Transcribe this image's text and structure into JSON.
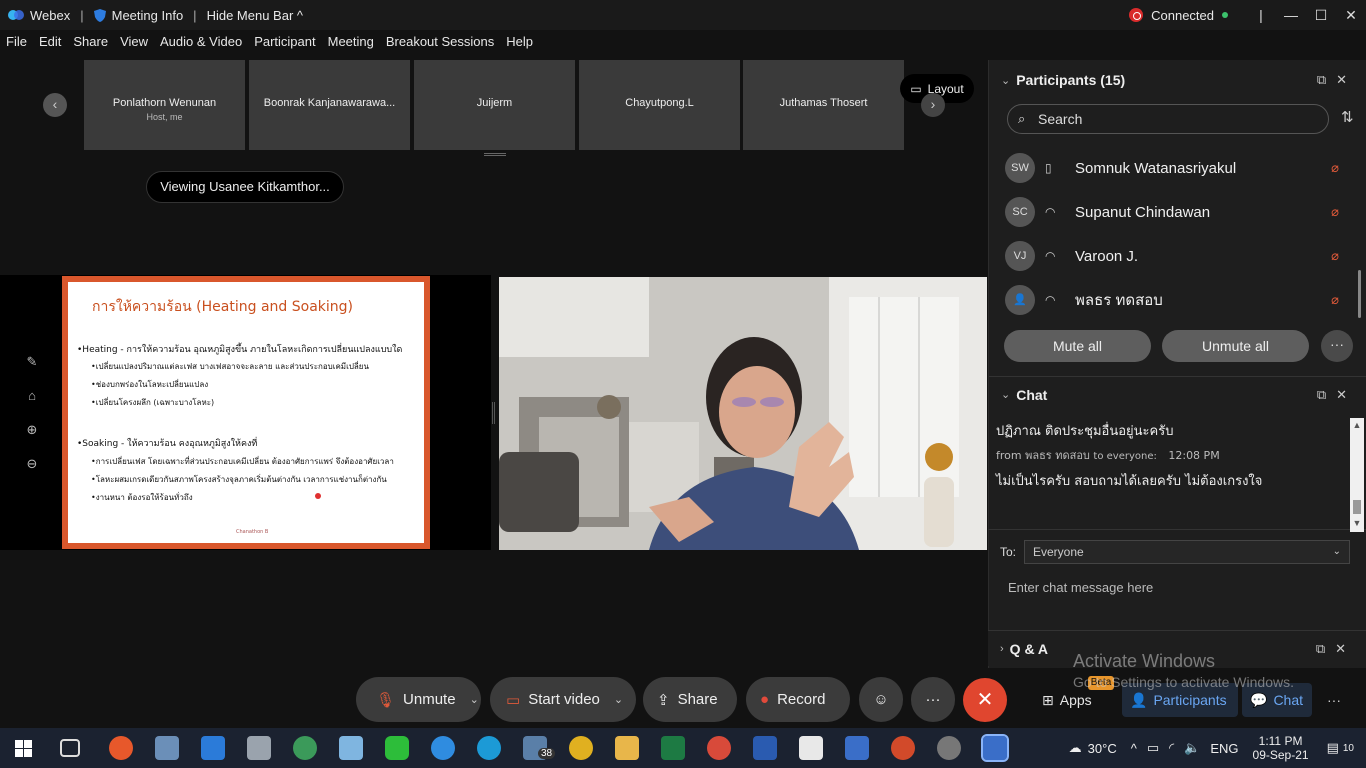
{
  "titlebar": {
    "app": "Webex",
    "meeting_info": "Meeting Info",
    "hide_menu": "Hide Menu Bar ^",
    "status": "Connected",
    "minimize": "—",
    "maximize": "☐",
    "close": "✕"
  },
  "menu": [
    "File",
    "Edit",
    "Share",
    "View",
    "Audio & Video",
    "Participant",
    "Meeting",
    "Breakout Sessions",
    "Help"
  ],
  "filmstrip": {
    "tiles": [
      {
        "name": "Ponlathorn Wenunan",
        "sub": "Host, me"
      },
      {
        "name": "Boonrak Kanjanawarawa..."
      },
      {
        "name": "Juijerm"
      },
      {
        "name": "Chayutpong.L"
      },
      {
        "name": "Juthamas Thosert"
      }
    ],
    "layout_label": "Layout"
  },
  "viewing": "Viewing Usanee Kitkamthor...",
  "slide": {
    "title": "การให้ความร้อน (Heating and Soaking)",
    "bullet1": "•Heating - การให้ความร้อน อุณหภูมิสูงขึ้น ภายในโลหะเกิดการเปลี่ยนแปลงแบบใด",
    "sub1": [
      "•เปลี่ยนแปลงปริมาณแต่ละเฟส  บางเฟสอาจจะละลาย และส่วนประกอบเคมีเปลี่ยน",
      "•ช่องบกพร่องในโลหะเปลี่ยนแปลง",
      "•เปลี่ยนโครงผลึก (เฉพาะบางโลหะ)"
    ],
    "bullet2": "•Soaking - ให้ความร้อน คงอุณหภูมิสูงให้คงที่",
    "sub2": [
      "•การเปลี่ยนเฟส โดยเฉพาะที่ส่วนประกอบเคมีเปลี่ยน ต้องอาศัยการแพร่ จึงต้องอาศัยเวลา",
      "•โลหะผสมเกรดเดียวกันสภาพโครงสร้างจุลภาคเริ่มต้นต่างกัน เวลาการแช่งานก็ต่างกัน",
      "•งานหนา ต้องรอให้ร้อนทั่วถึง"
    ],
    "footer": "Chanathon B"
  },
  "controls": {
    "unmute": "Unmute",
    "start_video": "Start video",
    "share": "Share",
    "record": "Record",
    "more": "···",
    "apps": "Apps",
    "participants": "Participants",
    "chat": "Chat",
    "beta": "Beta"
  },
  "participants": {
    "header": "Participants (15)",
    "search_placeholder": "Search",
    "rows": [
      {
        "initials": "SW",
        "name": "Somnuk Watanasriyakul"
      },
      {
        "initials": "SC",
        "name": "Supanut Chindawan"
      },
      {
        "initials": "VJ",
        "name": "Varoon J."
      },
      {
        "initials": "",
        "name": "พลธร ทดสอบ"
      }
    ],
    "mute_all": "Mute all",
    "unmute_all": "Unmute all"
  },
  "chat": {
    "header": "Chat",
    "prev_message": "ปฏิภาณ ติดประชุมอื่นอยู่นะครับ",
    "from_label": "from พลธร ทดสอบ",
    "to_label": "to everyone:",
    "time": "12:08 PM",
    "message": "ไม่เป็นไรครับ สอบถามได้เลยครับ ไม่ต้องเกรงใจ",
    "to": "To:",
    "recipient": "Everyone",
    "placeholder": "Enter chat message here"
  },
  "qa": {
    "header": "Q & A"
  },
  "activate": {
    "line1": "Activate Windows",
    "line2": "Go to Settings to activate Windows."
  },
  "taskbar": {
    "mail_badge": "38",
    "weather": "30°C",
    "lang": "ENG",
    "time": "1:11 PM",
    "date": "09-Sep-21",
    "notif": "10"
  }
}
